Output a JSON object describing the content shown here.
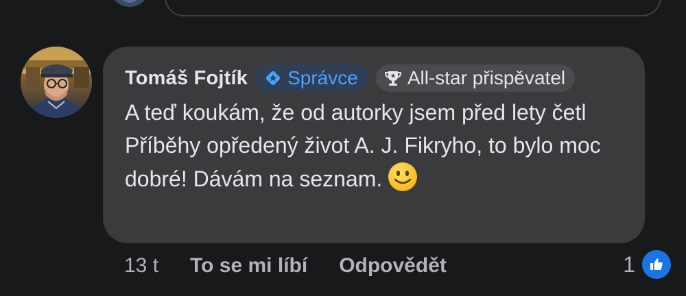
{
  "comment": {
    "author": "Tomáš Fojtík",
    "badges": [
      {
        "label": "Správce",
        "icon": "admin-star-icon"
      },
      {
        "label": "All-star přispěvatel",
        "icon": "trophy-icon"
      }
    ],
    "text": "A teď koukám, že od autorky jsem před lety četl Příběhy opředený život A. J. Fikryho, to bylo moc dobré! Dávám na seznam.",
    "emoji": "slightly-smiling-face-icon"
  },
  "actions": {
    "time": "13 t",
    "like": "To se mi líbí",
    "reply": "Odpovědět"
  },
  "reactions": {
    "count": "1",
    "icon": "thumbs-up-icon"
  },
  "colors": {
    "background": "#18191a",
    "bubble": "#3a3b3c",
    "accent": "#1b74e4",
    "admin_text": "#4aa2ff"
  }
}
